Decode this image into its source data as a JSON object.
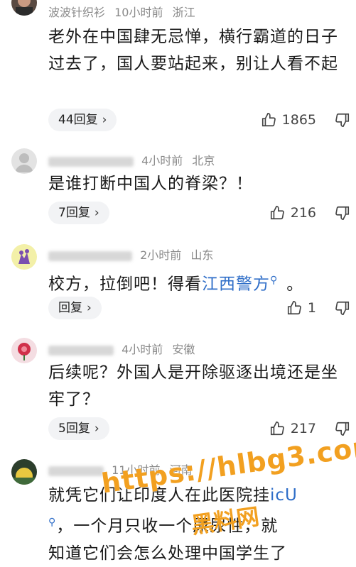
{
  "comments": [
    {
      "username": "波波针织衫",
      "time": "10小时前",
      "location": "浙江",
      "text": "老外在中国肆无忌惮，横行霸道的日子过去了，国人要站起来，别让人看不起",
      "reply_label": "44回复",
      "likes": "1865"
    },
    {
      "username": "",
      "time": "4小时前",
      "location": "北京",
      "text": "是谁打断中国人的脊梁？！",
      "reply_label": "7回复",
      "likes": "216"
    },
    {
      "username": "",
      "time": "2小时前",
      "location": "山东",
      "text_before": "校方，拉倒吧！得看",
      "text_link": "江西警方",
      "text_after": "。",
      "reply_label": "回复",
      "likes": "1"
    },
    {
      "username": "",
      "time": "4小时前",
      "location": "安徽",
      "text": "后续呢？外国人是开除驱逐出境还是坐牢了？",
      "reply_label": "5回复",
      "likes": "217"
    },
    {
      "username": "",
      "time": "11小时前",
      "location": "河南",
      "line1": "就凭它们让印度人在此医院挂",
      "line1_link": "icU",
      "line2": "，一个月只收一个尿尿性，就",
      "line3": "知道它们会怎么处理中国学生了"
    }
  ],
  "watermark": {
    "url": "https://hlbg3.com",
    "site": "黑料网"
  },
  "colors": {
    "link": "#2f6ec8",
    "watermark": "#f2a020",
    "meta": "#8a8a8a"
  }
}
